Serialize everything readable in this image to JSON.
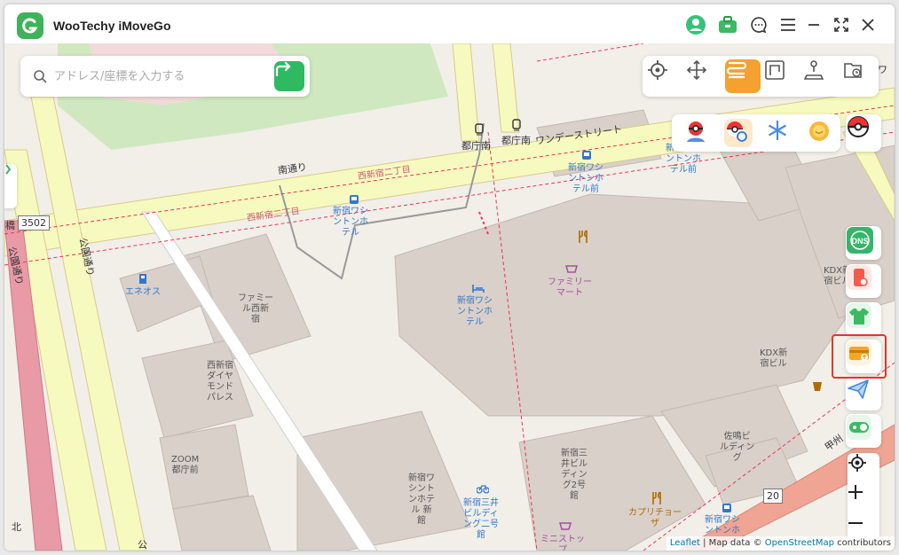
{
  "app": {
    "title": "WooTechy iMoveGo"
  },
  "colors": {
    "accent": "#2fba61",
    "mode_active": "#f4a12f",
    "highlight": "#e0372b"
  },
  "titlebar": {
    "icons": [
      "avatar-icon",
      "toolbox-icon",
      "chat-icon",
      "menu-icon",
      "minimize-icon",
      "fullscreen-icon",
      "close-icon"
    ]
  },
  "search": {
    "placeholder": "アドレス/座標を入力する",
    "value": ""
  },
  "modes": [
    "teleport-mode-icon",
    "joystick-mode-icon",
    "multi-spot-mode-icon",
    "two-spot-mode-icon",
    "jump-teleport-icon",
    "history-icon"
  ],
  "game_icons": [
    "pokemon-trainer-icon",
    "pokeball-search-icon",
    "freeze-icon",
    "coin-icon",
    "pokeball-icon"
  ],
  "side_buttons": [
    "dns-icon",
    "phone-icon",
    "shirt-icon",
    "card-export-icon",
    "send-icon",
    "toggle-icon"
  ],
  "map": {
    "labels": {
      "tochomae": "都庁南",
      "tochomae2": "都庁南",
      "wonder_street": "ワンデーストリート",
      "minami_dori": "南通り",
      "nishishinjuku_2a": "西新宿二丁目",
      "nishishinjuku_2b": "西新宿二丁目",
      "hotel_stop_1": "新宿ワシ\nントンホ\nテル",
      "hotel_stop_2": "新宿ワシ\nントンホ\nテル前",
      "hotel_stop_3": "新宿ワシ\nントンホ\nテル前",
      "eneos": "エネオス",
      "familie_bldg": "ファミー\nル西新\n宿",
      "hotel_main": "新宿ワシ\nントンホ\nテル",
      "family_mart": "ファミリー\nマート",
      "kdx_1": "KDX新\n宿ビル",
      "kdx_2": "KDX新\n宿ビル",
      "diamond": "西新宿\nダイヤ\nモンド\nパレス",
      "zoom": "ZOOM\n都庁前",
      "hotel_new": "新宿ワ\nシント\nンホテ\nル 新\n館",
      "mitsui_2": "新宿三\n井ビル\nディン\nグ2号\n館",
      "mitsui_stop": "新宿三井\nビルディ\nング二号\n館",
      "capricciosa": "カプリチョー\nザ",
      "ministop": "ミニストッ\nプ",
      "hotel_stop_4": "新宿ワシ\nントンホ",
      "saginomiya": "佐鳴ビ\nルディン\nグ",
      "koshu": "甲州",
      "koen_dori": "公園通り",
      "koen_dori_2": "公園通り",
      "hashi": "橋",
      "komae": "公",
      "kita": "北",
      "route_3502": "3502",
      "route_20": "20",
      "tower_right": "ワ"
    }
  },
  "attribution": {
    "leaflet": "Leaflet",
    "sep": " | Map data © ",
    "osm": "OpenStreetMap",
    "tail": " contributors"
  }
}
